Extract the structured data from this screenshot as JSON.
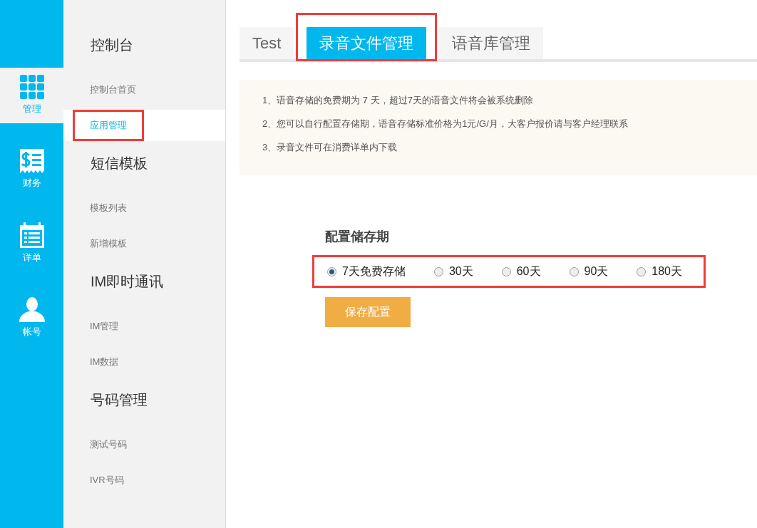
{
  "rail": [
    {
      "kind": "grid",
      "label": "管理",
      "selected": true
    },
    {
      "kind": "receipt",
      "label": "财务",
      "selected": false
    },
    {
      "kind": "calendar",
      "label": "详单",
      "selected": false
    },
    {
      "kind": "user",
      "label": "帐号",
      "selected": false
    }
  ],
  "sidebar": {
    "sections": [
      {
        "title": "控制台",
        "items": [
          {
            "label": "控制台首页",
            "selected": false,
            "highlighted": false
          },
          {
            "label": "应用管理",
            "selected": true,
            "highlighted": true
          }
        ]
      },
      {
        "title": "短信模板",
        "items": [
          {
            "label": "模板列表",
            "selected": false,
            "highlighted": false
          },
          {
            "label": "新增模板",
            "selected": false,
            "highlighted": false
          }
        ]
      },
      {
        "title": "IM即时通讯",
        "items": [
          {
            "label": "IM管理",
            "selected": false,
            "highlighted": false
          },
          {
            "label": "IM数据",
            "selected": false,
            "highlighted": false
          }
        ]
      },
      {
        "title": "号码管理",
        "items": [
          {
            "label": "测试号码",
            "selected": false,
            "highlighted": false
          },
          {
            "label": "IVR号码",
            "selected": false,
            "highlighted": false
          }
        ]
      }
    ]
  },
  "tabs": [
    {
      "label": "Test",
      "selected": false,
      "highlighted": false
    },
    {
      "label": "录音文件管理",
      "selected": true,
      "highlighted": true
    },
    {
      "label": "语音库管理",
      "selected": false,
      "highlighted": false
    }
  ],
  "notice": [
    "1、语音存储的免费期为 7 天，超过7天的语音文件将会被系统删除",
    "2、您可以自行配置存储期，语音存储标准价格为1元/G/月，大客户报价请与客户经理联系",
    "3、录音文件可在消费详单内下载"
  ],
  "storage": {
    "title": "配置储存期",
    "highlighted": true,
    "options": [
      {
        "label": "7天免费存储",
        "selected": true
      },
      {
        "label": "30天",
        "selected": false
      },
      {
        "label": "60天",
        "selected": false
      },
      {
        "label": "90天",
        "selected": false
      },
      {
        "label": "180天",
        "selected": false
      }
    ],
    "save_button": "保存配置"
  }
}
